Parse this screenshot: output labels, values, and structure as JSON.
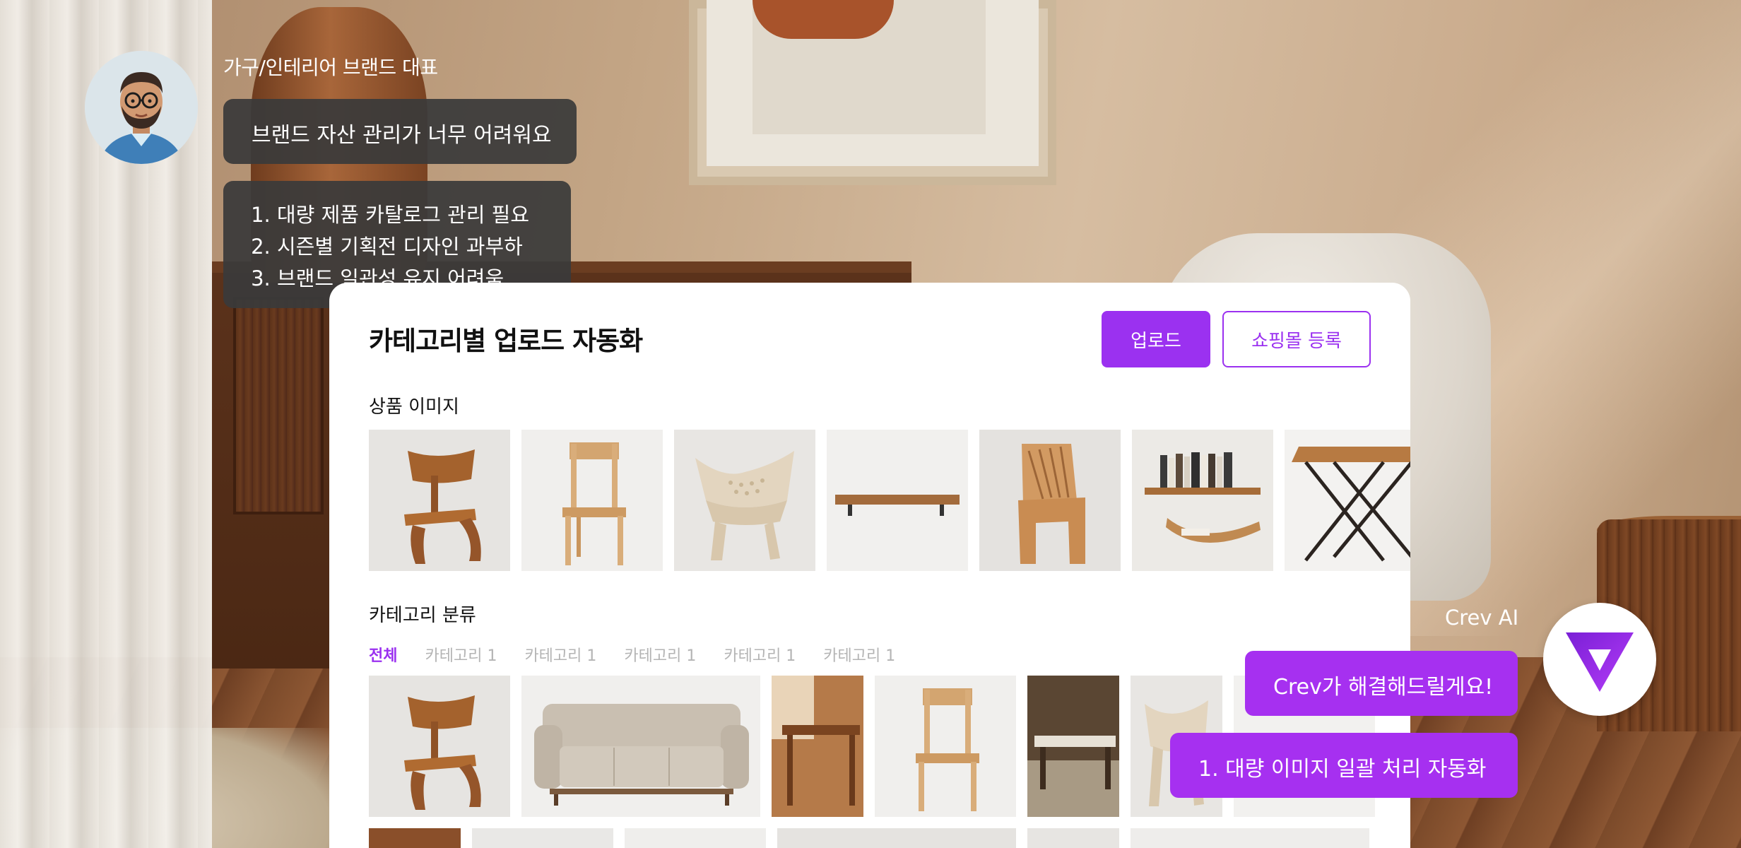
{
  "persona": {
    "name": "가구/인테리어 브랜드 대표",
    "pain_headline": "브랜드 자산 관리가 너무 어려워요",
    "pain_points": [
      "대량 제품 카탈로그 관리 필요",
      "시즌별 기획전 디자인 과부하",
      "브랜드 일관성 유지 어려움"
    ]
  },
  "card": {
    "title": "카테고리별 업로드 자동화",
    "upload_button": "업로드",
    "register_button": "쇼핑몰 등록",
    "product_images_label": "상품 이미지",
    "category_label": "카테고리 분류",
    "tabs": [
      "전체",
      "카테고리 1",
      "카테고리 1",
      "카테고리 1",
      "카테고리 1",
      "카테고리 1"
    ],
    "active_tab": 0
  },
  "ai": {
    "name": "Crev AI",
    "message": "Crev가 해결해드릴게요!",
    "solutions": [
      "대량 이미지 일괄 처리 자동화"
    ]
  },
  "colors": {
    "accent": "#9b31f0",
    "bubble_purple": "#a630f0",
    "bubble_dark": "#3a3a3a"
  }
}
